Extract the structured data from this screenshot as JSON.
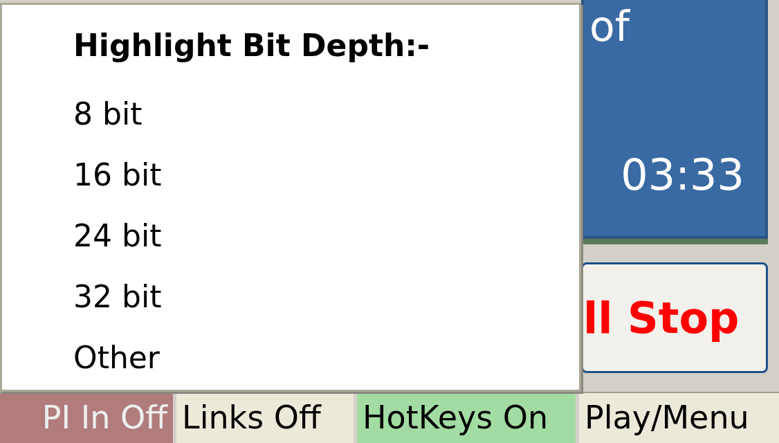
{
  "display": {
    "title": "of",
    "time": "03:33"
  },
  "stop_button": {
    "label": "ll Stop"
  },
  "status_bar": [
    {
      "label": "PI In Off",
      "color": "#b07c7c"
    },
    {
      "label": "Links Off",
      "color": "#ece9d8"
    },
    {
      "label": "HotKeys On",
      "color": "#a3dca3"
    },
    {
      "label": "Play/Menu",
      "color": "#ece9d8"
    }
  ],
  "context_menu": {
    "title": "Highlight Bit Depth:-",
    "items": [
      "8 bit",
      "16 bit",
      "24 bit",
      "32 bit",
      "Other"
    ]
  }
}
